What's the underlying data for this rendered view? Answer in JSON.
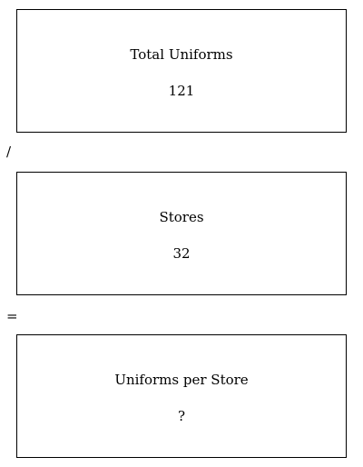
{
  "boxes": [
    {
      "label": "Total Uniforms",
      "value": "121"
    },
    {
      "label": "Stores",
      "value": "32"
    },
    {
      "label": "Uniforms per Store",
      "value": "?"
    }
  ],
  "operators": [
    "/",
    "="
  ]
}
